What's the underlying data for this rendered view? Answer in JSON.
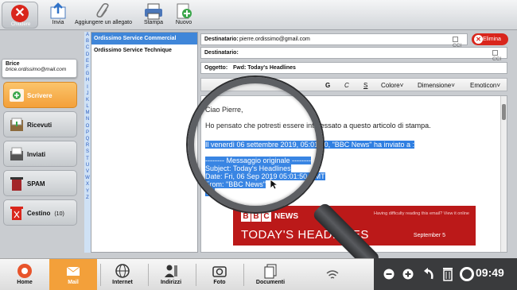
{
  "toolbar": {
    "close_label": "Chiudere",
    "send_label": "Invia",
    "attach_label": "Aggiungere un allegato",
    "print_label": "Stampa",
    "new_label": "Nuovo"
  },
  "account": {
    "name": "Brice",
    "email": "brice.ordissimo@mail.com"
  },
  "folders": [
    {
      "label": "Scrivere"
    },
    {
      "label": "Ricevuti"
    },
    {
      "label": "Inviati"
    },
    {
      "label": "SPAM"
    },
    {
      "label": "Cestino",
      "count": "(10)"
    }
  ],
  "alphabet": [
    "A",
    "B",
    "C",
    "D",
    "E",
    "F",
    "G",
    "H",
    "I",
    "J",
    "K",
    "L",
    "M",
    "N",
    "O",
    "P",
    "Q",
    "R",
    "S",
    "T",
    "U",
    "V",
    "W",
    "X",
    "Y",
    "Z"
  ],
  "contacts": [
    "Ordissimo Service Commercial",
    "Ordissimo Service Technique"
  ],
  "compose": {
    "to_label": "Destinatario:",
    "to_value": "pierre.ordissimo@gmail.com",
    "to2_label": "Destinatario:",
    "cci_label": "CCI",
    "subject_label": "Oggetto:",
    "subject_value": "Fwd: Today's Headlines",
    "delete_label": "Elimina"
  },
  "format": {
    "bold": "G",
    "italic": "C",
    "underline": "S",
    "color": "Colore˅",
    "size": "Dimensione˅",
    "emoticon": "Emoticon˅"
  },
  "body": {
    "greeting": "Ciao Pierre,",
    "line1": "Ho pensato che potresti essere interessato a questo articolo di stampa.",
    "quote_intro": "Il venerdì 06 settembre 2019, 05:01:50, \"BBC News\" ha inviato a :",
    "orig_sep": "-------- Messaggio originale --------",
    "orig_subject": "Subject: Today's Headlines",
    "orig_date": "Date: Fri, 06 Sep 2019 05:01:50 GMT",
    "orig_from": "From: \"BBC News\"",
    "orig_to": "To:"
  },
  "banner": {
    "logo": [
      "B",
      "B",
      "C"
    ],
    "news": "NEWS",
    "note": "Having difficulty reading this email? View it online",
    "headline": "TODAY'S HEADLINES",
    "date": "September 5"
  },
  "dock": [
    {
      "label": "Home"
    },
    {
      "label": "Mail"
    },
    {
      "label": "Internet"
    },
    {
      "label": "Indirizzi"
    },
    {
      "label": "Foto"
    },
    {
      "label": "Documenti"
    }
  ],
  "clock": "09:49"
}
